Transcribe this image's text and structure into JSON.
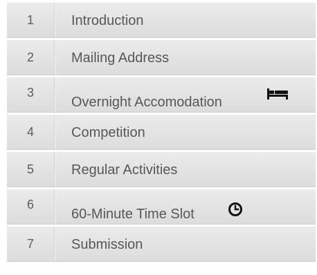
{
  "steps": [
    {
      "number": "1",
      "label": "Introduction"
    },
    {
      "number": "2",
      "label": "Mailing Address"
    },
    {
      "number": "3",
      "label": "Overnight Accomodation",
      "icon": "bed-icon"
    },
    {
      "number": "4",
      "label": "Competition"
    },
    {
      "number": "5",
      "label": "Regular Activities"
    },
    {
      "number": "6",
      "label": "60-Minute Time Slot",
      "icon": "clock-icon"
    },
    {
      "number": "7",
      "label": "Submission"
    }
  ],
  "colors": {
    "row_top": "#ebebeb",
    "row_bottom": "#dcdcdc",
    "text": "#575757"
  }
}
